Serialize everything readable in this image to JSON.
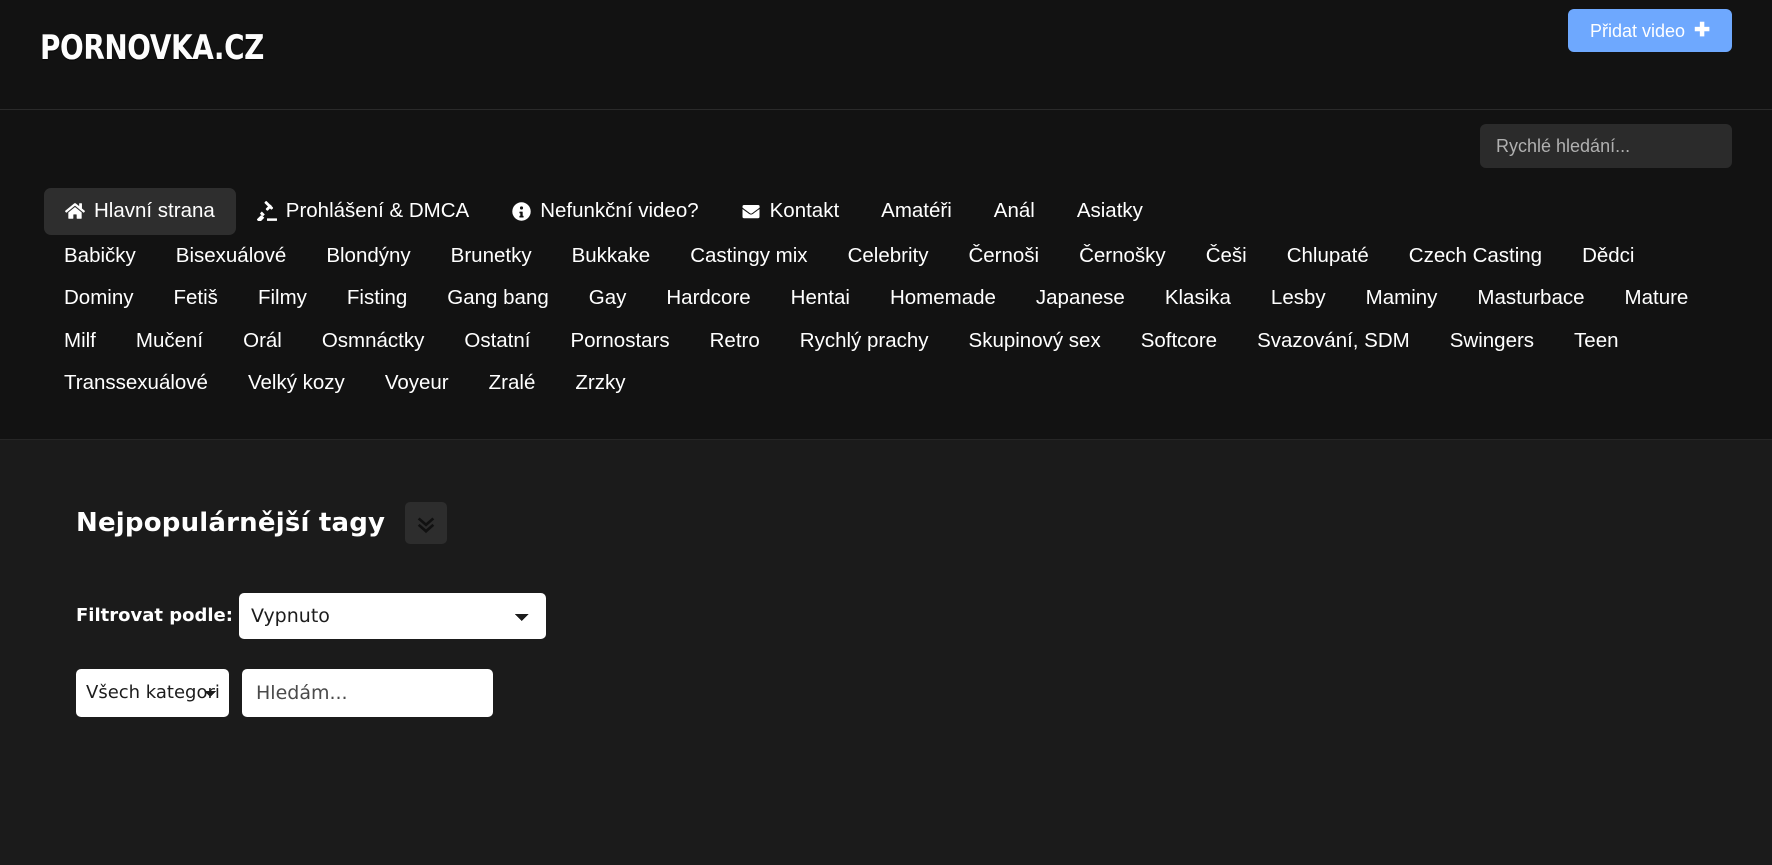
{
  "site": {
    "logo_text": "PORNOVKA.CZ",
    "accent_color": "#6ea8fe",
    "background_color": "#121212",
    "panel_background_color": "#1b1b1b"
  },
  "header": {
    "add_video_label": "Přidat video",
    "add_video_icon": "plus-icon",
    "plus_glyph": "✚"
  },
  "search": {
    "quick_placeholder": "Rychlé hledání...",
    "quick_value": ""
  },
  "nav": {
    "primary": [
      {
        "label": "Hlavní strana",
        "icon": "home-icon",
        "active": true
      },
      {
        "label": "Prohlášení & DMCA",
        "icon": "gavel-icon",
        "active": false
      },
      {
        "label": "Nefunkční video?",
        "icon": "exclamation-circle-icon",
        "active": false
      },
      {
        "label": "Kontakt",
        "icon": "envelope-icon",
        "active": false
      },
      {
        "label": "Amatéři",
        "icon": "",
        "active": false
      },
      {
        "label": "Anál",
        "icon": "",
        "active": false
      },
      {
        "label": "Asiatky",
        "icon": "",
        "active": false
      }
    ],
    "categories": [
      "Babičky",
      "Bisexuálové",
      "Blondýny",
      "Brunetky",
      "Bukkake",
      "Castingy mix",
      "Celebrity",
      "Černoši",
      "Černošky",
      "Češi",
      "Chlupaté",
      "Czech Casting",
      "Dědci",
      "Dominy",
      "Fetiš",
      "Filmy",
      "Fisting",
      "Gang bang",
      "Gay",
      "Hardcore",
      "Hentai",
      "Homemade",
      "Japanese",
      "Klasika",
      "Lesby",
      "Maminy",
      "Masturbace",
      "Mature",
      "Milf",
      "Mučení",
      "Orál",
      "Osmnáctky",
      "Ostatní",
      "Pornostars",
      "Retro",
      "Rychlý prachy",
      "Skupinový sex",
      "Softcore",
      "Svazování, SDM",
      "Swingers",
      "Teen",
      "Transsexuálové",
      "Velký kozy",
      "Voyeur",
      "Zralé",
      "Zrzky"
    ]
  },
  "tags_panel": {
    "title": "Nejpopulárnější tagy",
    "expand_icon": "double-chevron-down-icon",
    "filter_label": "Filtrovat podle:",
    "filter_value": "Vypnuto",
    "filter_options": [
      "Vypnuto"
    ],
    "category_value": "Všech kategorií",
    "category_options": [
      "Všech kategorií"
    ],
    "term_placeholder": "Hledám...",
    "term_value": ""
  }
}
